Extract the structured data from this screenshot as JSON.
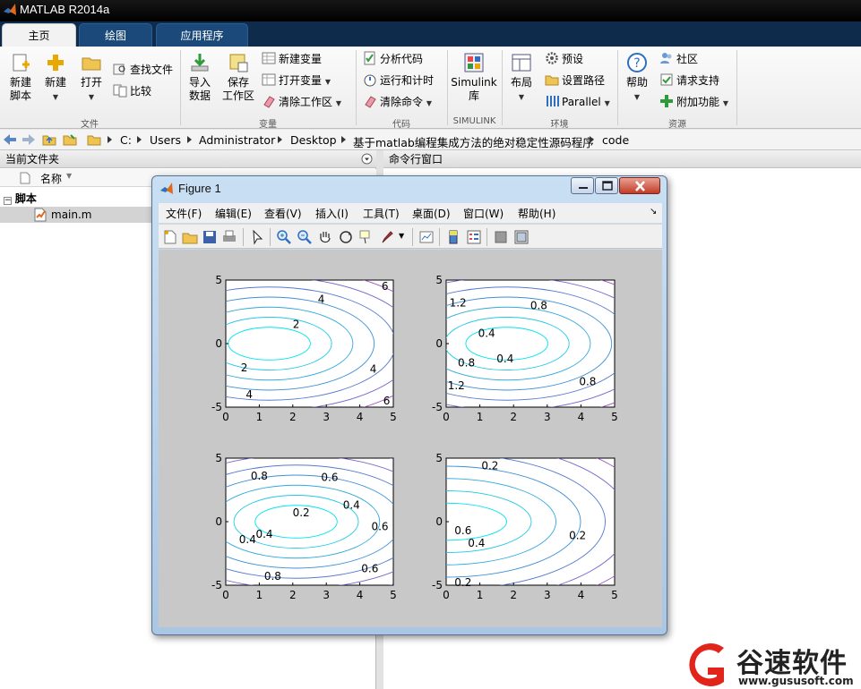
{
  "window": {
    "title": "MATLAB R2014a"
  },
  "tabs": [
    {
      "label": "主页",
      "active": true
    },
    {
      "label": "绘图",
      "active": false
    },
    {
      "label": "应用程序",
      "active": false
    }
  ],
  "ribbon": {
    "file": {
      "group": "文件",
      "new_script": "新建\n脚本",
      "new": "新建",
      "open": "打开",
      "find_files": "查找文件",
      "compare": "比较"
    },
    "variable": {
      "group": "变量",
      "import": "导入\n数据",
      "save": "保存\n工作区",
      "new_var": "新建变量",
      "open_var": "打开变量",
      "clear_ws": "清除工作区"
    },
    "code": {
      "group": "代码",
      "analyze": "分析代码",
      "run_time": "运行和计时",
      "clear_cmd": "清除命令"
    },
    "simulink": {
      "group": "SIMULINK",
      "lib": "Simulink\n库"
    },
    "env": {
      "group": "环境",
      "layout": "布局",
      "prefs": "预设",
      "set_path": "设置路径",
      "parallel": "Parallel"
    },
    "resources": {
      "group": "资源",
      "help": "帮助",
      "community": "社区",
      "request_support": "请求支持",
      "addons": "附加功能"
    }
  },
  "address": {
    "crumbs": [
      "C:",
      "Users",
      "Administrator",
      "Desktop",
      "基于matlab编程集成方法的绝对稳定性源码程序",
      "code"
    ]
  },
  "current_folder": {
    "title": "当前文件夹",
    "column": "名称",
    "group": "脚本",
    "file": "main.m"
  },
  "command_window": {
    "title": "命令行窗口"
  },
  "figure": {
    "title": "Figure 1",
    "menu": [
      "文件(F)",
      "编辑(E)",
      "查看(V)",
      "插入(I)",
      "工具(T)",
      "桌面(D)",
      "窗口(W)",
      "帮助(H)"
    ]
  },
  "chart_data": [
    {
      "type": "contour",
      "xlim": [
        0,
        5
      ],
      "ylim": [
        -5,
        5
      ],
      "xticks": [
        "0",
        "1",
        "2",
        "3",
        "4",
        "5"
      ],
      "yticks": [
        "5",
        "0",
        "-5"
      ],
      "contour_labels": [
        "6",
        "4",
        "2",
        "2",
        "4",
        "4",
        "6"
      ],
      "center": [
        1.3,
        0
      ]
    },
    {
      "type": "contour",
      "xlim": [
        0,
        5
      ],
      "ylim": [
        -5,
        5
      ],
      "xticks": [
        "0",
        "1",
        "2",
        "3",
        "4",
        "5"
      ],
      "yticks": [
        "5",
        "0",
        "-5"
      ],
      "contour_labels": [
        "1.2",
        "0.8",
        "0.4",
        "0.4",
        "0.8",
        "0.8",
        "1.2"
      ],
      "center": [
        1.8,
        0
      ]
    },
    {
      "type": "contour",
      "xlim": [
        0,
        5
      ],
      "ylim": [
        -5,
        5
      ],
      "xticks": [
        "0",
        "1",
        "2",
        "3",
        "4",
        "5"
      ],
      "yticks": [
        "5",
        "0",
        "-5"
      ],
      "contour_labels": [
        "0.8",
        "0.6",
        "0.4",
        "0.2",
        "0.4",
        "0.6",
        "0.4",
        "0.6",
        "0.8"
      ],
      "center": [
        2.1,
        0
      ]
    },
    {
      "type": "contour",
      "xlim": [
        0,
        5
      ],
      "ylim": [
        -5,
        5
      ],
      "xticks": [
        "0",
        "1",
        "2",
        "3",
        "4",
        "5"
      ],
      "yticks": [
        "5",
        "0",
        "-5"
      ],
      "contour_labels": [
        "0.2",
        "0.6",
        "0.4",
        "0.2",
        "0.2"
      ],
      "center": [
        0,
        0
      ]
    }
  ],
  "watermark": {
    "name": "谷速软件",
    "url": "www.gususoft.com"
  }
}
